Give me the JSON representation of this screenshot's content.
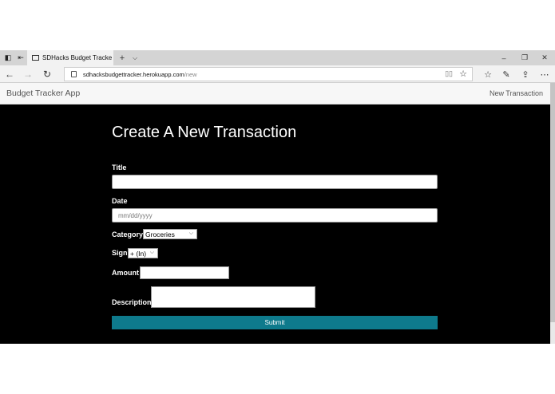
{
  "browser": {
    "tab_title": "SDHacks Budget Tracke",
    "new_tab_symbol": "+",
    "tab_menu_symbol": "⌵",
    "url_domain": "sdhacksbudgettracker.herokuapp.com",
    "url_path": "/new"
  },
  "app": {
    "brand": "Budget Tracker App",
    "nav_new_transaction": "New Transaction"
  },
  "form": {
    "heading": "Create A New Transaction",
    "title_label": "Title",
    "title_value": "",
    "date_label": "Date",
    "date_placeholder": "mm/dd/yyyy",
    "category_label": "Category",
    "category_selected": "Groceries",
    "sign_label": "Sign",
    "sign_selected": "+ (In)",
    "amount_label": "Amount",
    "amount_value": "",
    "description_label": "Description",
    "description_value": "",
    "submit_label": "Submit"
  },
  "colors": {
    "submit_bg": "#0e7a8c",
    "content_bg": "#000000",
    "navbar_bg": "#f7f7f7"
  }
}
